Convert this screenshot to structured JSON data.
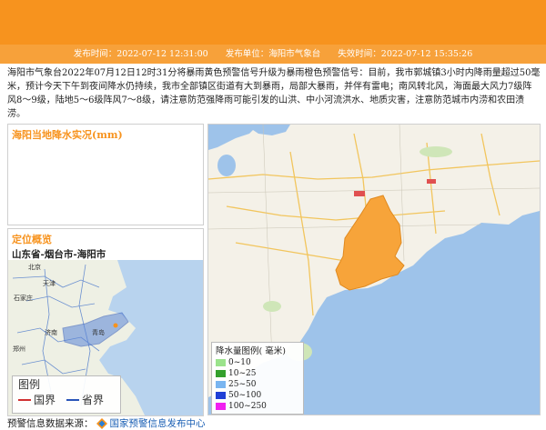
{
  "info_bar": {
    "publish_time": "发布时间：2022-07-12 12:31:00",
    "publisher": "发布单位：海阳市气象台",
    "expire_time": "失效时间：2022-07-12 15:35:26"
  },
  "description": "海阳市气象台2022年07月12日12时31分将暴雨黄色预警信号升级为暴雨橙色预警信号：目前，我市郭城镇3小时内降雨量超过50毫米，预计今天下午到夜间降水仍持续，我市全部镇区街道有大到暴雨，局部大暴雨，并伴有雷电；南风转北风，海面最大风力7级阵风8～9级，陆地5～6级阵风7～8级，请注意防范强降雨可能引发的山洪、中小河流洪水、地质灾害，注意防范城市内涝和农田渍涝。",
  "rain_panel": {
    "title": "海阳当地降水实况(mm)"
  },
  "location_panel": {
    "title": "定位概览",
    "location": "山东省-烟台市-海阳市",
    "mini_map_labels": [
      "北京",
      "天津",
      "石家庄",
      "济南",
      "青岛",
      "郑州"
    ],
    "legend_title": "图例",
    "legend_border": "国界",
    "legend_province": "省界"
  },
  "big_map": {
    "legend_title": "降水量图例( 毫米)",
    "legend_items": [
      {
        "label": "0~10",
        "color": "#9be38b"
      },
      {
        "label": "10~25",
        "color": "#34a02c"
      },
      {
        "label": "25~50",
        "color": "#79b5f0"
      },
      {
        "label": "50~100",
        "color": "#1f3fd6"
      },
      {
        "label": "100~250",
        "color": "#f01ff0"
      }
    ],
    "colors": {
      "sea": "#9ec3ea",
      "land": "#f4f1e8",
      "warning_area": "#f7a43a"
    }
  },
  "footer": {
    "prefix": "预警信息数据来源：",
    "source_link": "国家预警信息发布中心"
  },
  "colors": {
    "banner": "#f7931e",
    "info_bar": "#f7a13a",
    "title": "#f7931e"
  }
}
